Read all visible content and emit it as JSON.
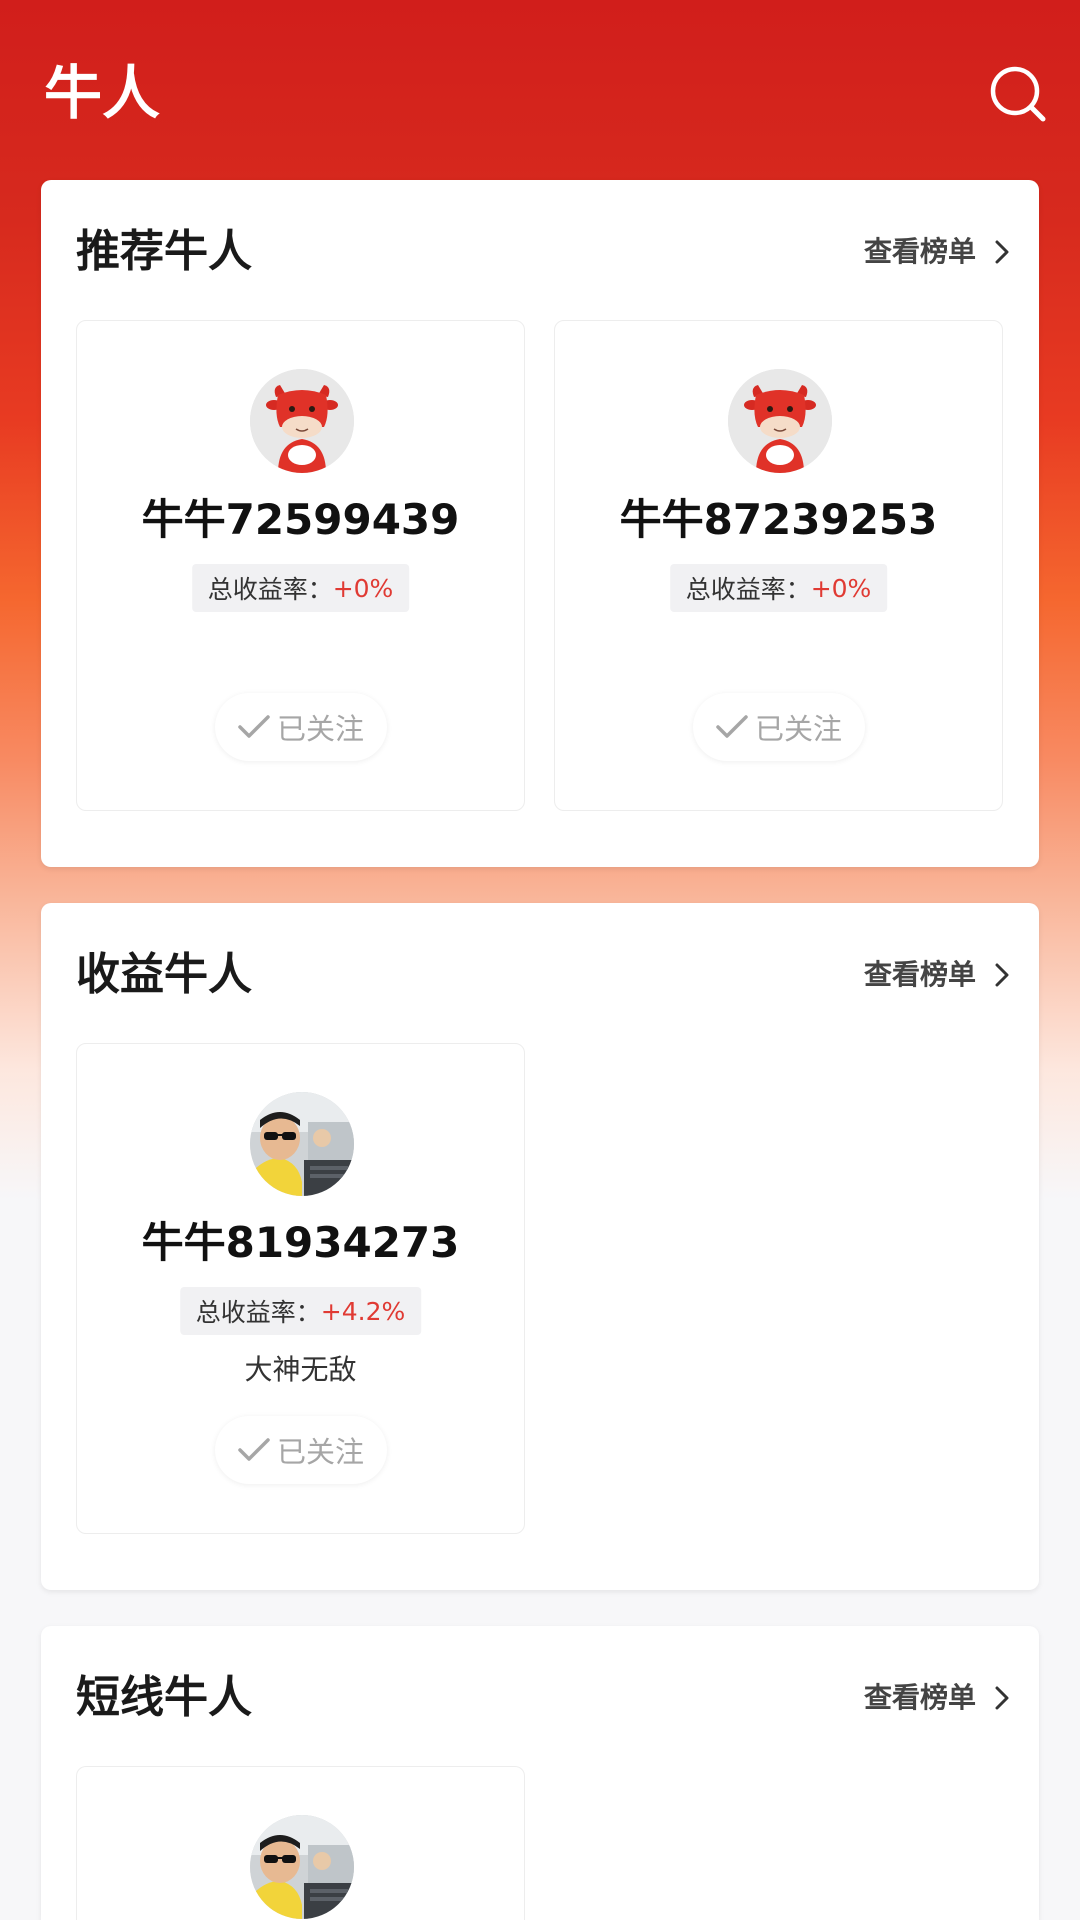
{
  "header": {
    "title": "牛人"
  },
  "sections": [
    {
      "title": "推荐牛人",
      "link": "查看榜单",
      "cards": [
        {
          "name": "牛牛72599439",
          "rate_label": "总收益率：",
          "rate_value": "+0%",
          "bio": "",
          "follow_label": "已关注",
          "avatar": "cow-mascot"
        },
        {
          "name": "牛牛87239253",
          "rate_label": "总收益率：",
          "rate_value": "+0%",
          "bio": "",
          "follow_label": "已关注",
          "avatar": "cow-mascot"
        }
      ]
    },
    {
      "title": "收益牛人",
      "link": "查看榜单",
      "cards": [
        {
          "name": "牛牛81934273",
          "rate_label": "总收益率：",
          "rate_value": "+4.2%",
          "bio": "大神无敌",
          "follow_label": "已关注",
          "avatar": "user-photo"
        }
      ]
    },
    {
      "title": "短线牛人",
      "link": "查看榜单",
      "cards": [
        {
          "avatar": "user-photo"
        }
      ]
    }
  ],
  "colors": {
    "brand_red": "#d11e1b",
    "accent_orange": "#f5672f",
    "rate_red": "#e03a33"
  },
  "icons": {
    "search": "search-icon",
    "arrow": "chevron-right-icon",
    "check": "check-icon"
  }
}
